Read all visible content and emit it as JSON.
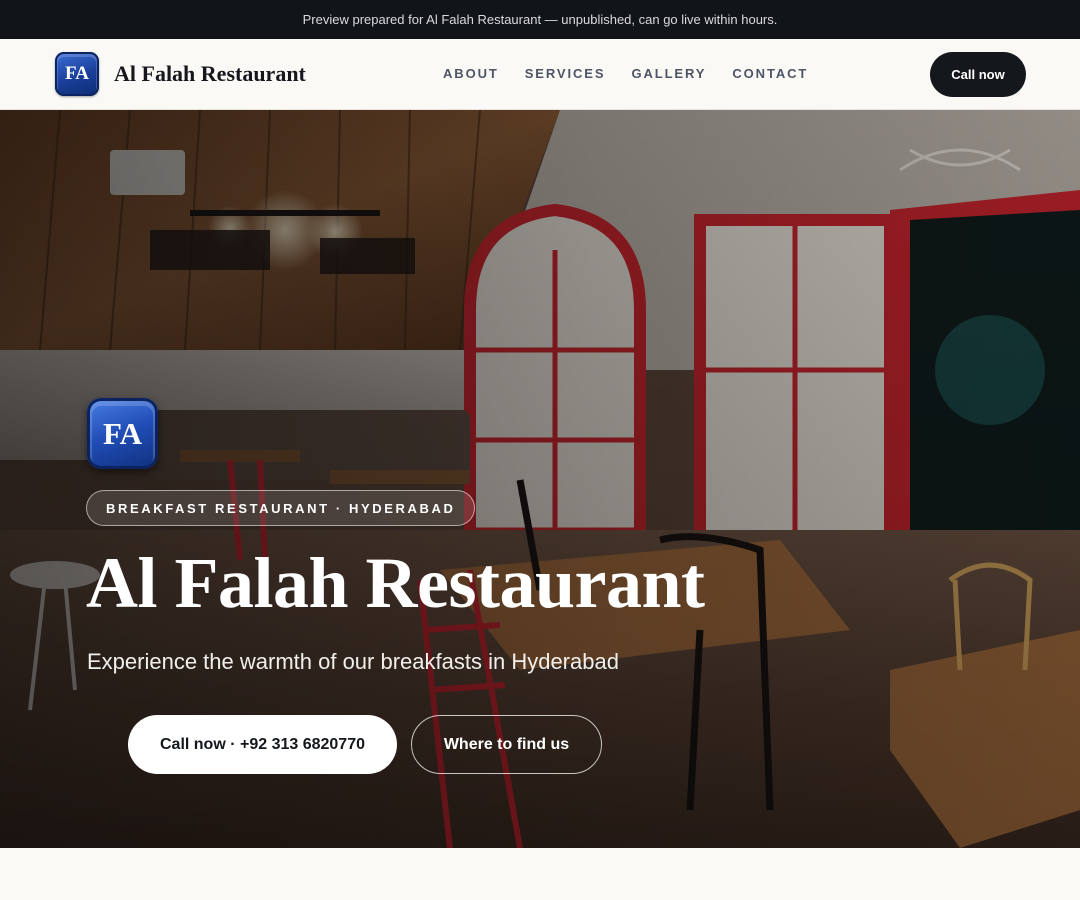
{
  "announcement": "Preview prepared for Al Falah Restaurant — unpublished, can go live within hours.",
  "brand": {
    "initials": "FA",
    "name": "Al Falah Restaurant"
  },
  "nav": {
    "links": [
      "ABOUT",
      "SERVICES",
      "GALLERY",
      "CONTACT"
    ],
    "cta": "Call now"
  },
  "hero": {
    "badge_initials": "FA",
    "tag": "BREAKFAST RESTAURANT · HYDERABAD",
    "title": "Al Falah Restaurant",
    "subtitle": "Experience the warmth of our breakfasts in Hyderabad",
    "primary_button": "Call now · +92 313 6820770",
    "secondary_button": "Where to find us"
  },
  "colors": {
    "topbar": "#111419",
    "nav_background": "#faf9f6",
    "cta_background": "#14171c",
    "badge_blue": "#1f4cb5",
    "door_red": "#c8232c"
  },
  "icons": {
    "logo": "fa-monogram-badge",
    "hero_logo": "fa-monogram-badge"
  }
}
